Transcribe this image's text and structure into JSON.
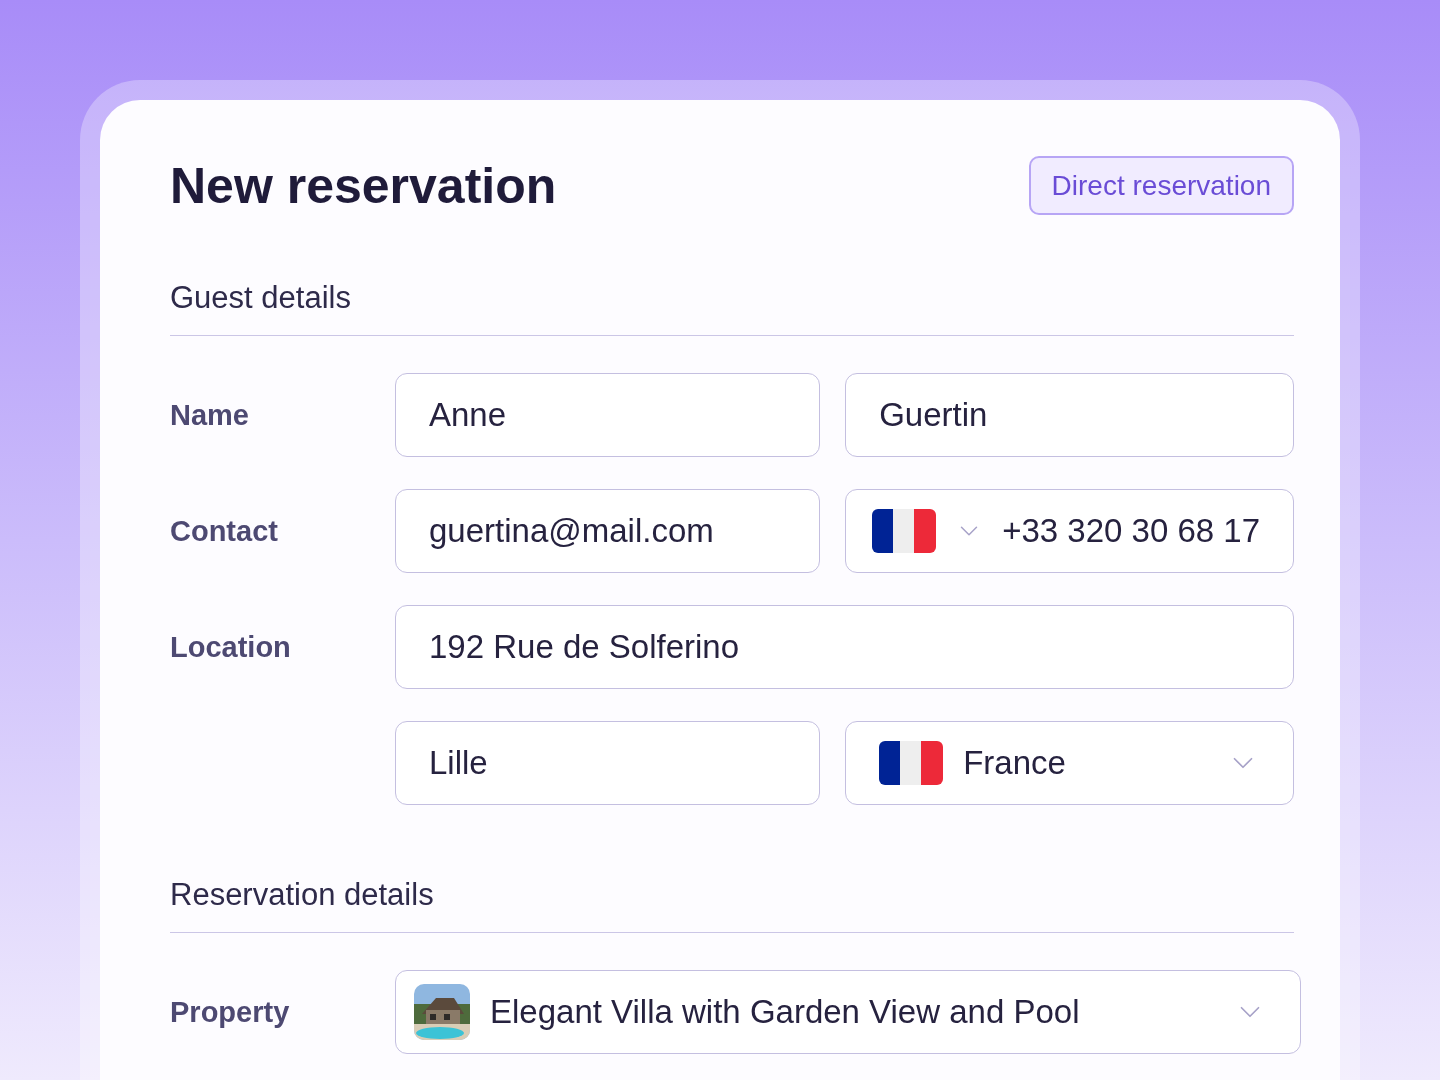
{
  "header": {
    "title": "New reservation",
    "badge": "Direct reservation"
  },
  "sections": [
    {
      "title": "Guest details",
      "rows": [
        {
          "label": "Name",
          "fields": [
            {
              "kind": "text",
              "value": "Anne"
            },
            {
              "kind": "text",
              "value": "Guertin"
            }
          ]
        },
        {
          "label": "Contact",
          "fields": [
            {
              "kind": "text",
              "value": "guertina@mail.com"
            },
            {
              "kind": "phone",
              "value": "+33 320 30 68 17"
            }
          ]
        },
        {
          "label": "Location",
          "fields": [
            {
              "kind": "text",
              "value": "192 Rue de Solferino"
            }
          ]
        },
        {
          "fields": [
            {
              "kind": "text",
              "value": "Lille"
            },
            {
              "kind": "country",
              "value": "France"
            }
          ]
        }
      ]
    },
    {
      "title": "Reservation details",
      "rows": [
        {
          "label": "Property",
          "fields": [
            {
              "kind": "property",
              "value": "Elegant Villa with Garden View and Pool"
            }
          ]
        }
      ]
    }
  ]
}
